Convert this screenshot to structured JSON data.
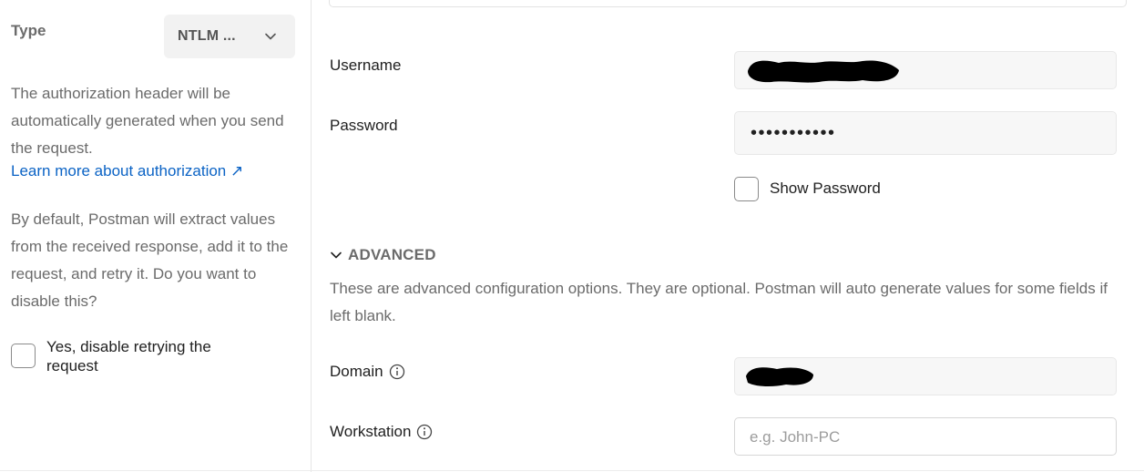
{
  "auth_type": {
    "label": "Type",
    "selected": "NTLM ...",
    "description": "The authorization header will be automatically generated when you send the request.",
    "learn_more": "Learn more about authorization ↗",
    "retry_description": "By default, Postman will extract values from the received response, add it to the request, and retry it. Do you want to disable this?",
    "disable_retry_label": "Yes, disable retrying the request",
    "disable_retry_checked": false
  },
  "credentials": {
    "username_label": "Username",
    "password_label": "Password",
    "password_value": "•••••••••••",
    "show_password_label": "Show Password",
    "show_password_checked": false
  },
  "advanced": {
    "title": "ADVANCED",
    "description": "These are advanced configuration options. They are optional. Postman will auto generate values for some fields if left blank.",
    "domain_label": "Domain",
    "workstation_label": "Workstation",
    "workstation_placeholder": "e.g. John-PC"
  },
  "icons": {
    "chevron": "chevron-down-icon",
    "info": "info-icon"
  },
  "colors": {
    "link": "#0b63c5",
    "muted_text": "#6b6b6b",
    "input_bg": "#f7f7f7"
  }
}
